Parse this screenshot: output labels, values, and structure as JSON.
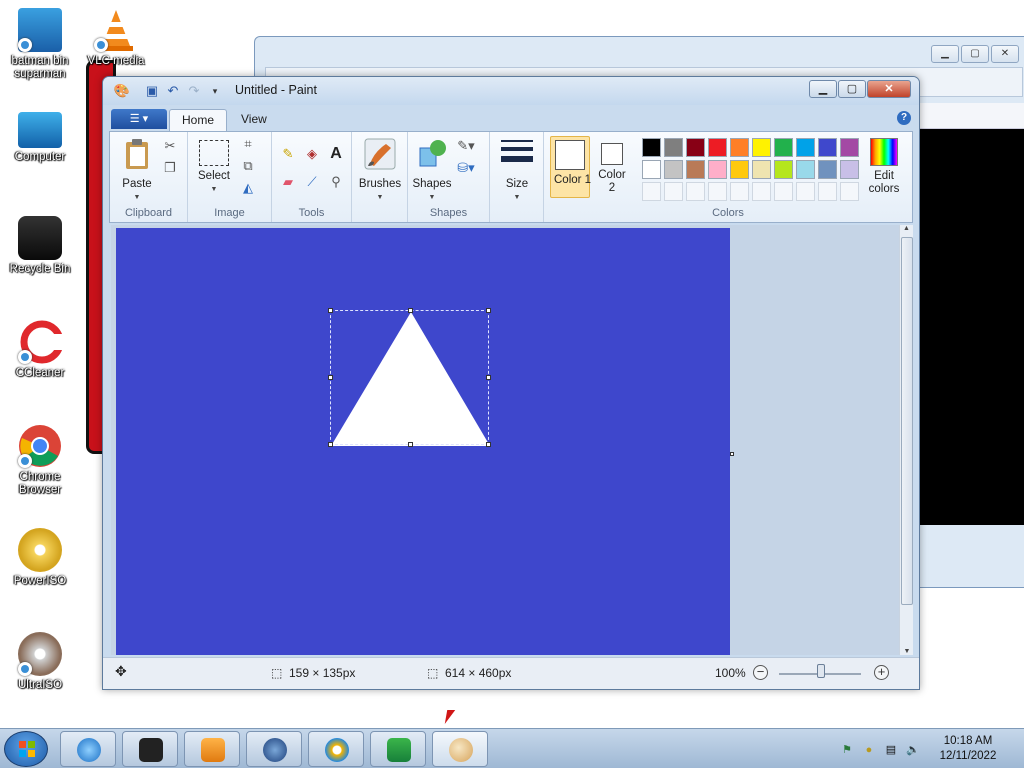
{
  "desktop": {
    "icons": [
      {
        "label": "batman bin suparman"
      },
      {
        "label": "VLC media"
      },
      {
        "label": "Computer"
      },
      {
        "label": "Recycle Bin"
      },
      {
        "label": "CCleaner"
      },
      {
        "label": "Chrome Browser"
      },
      {
        "label": "PowerISO"
      },
      {
        "label": "UltraISO"
      }
    ]
  },
  "paint": {
    "title": "Untitled - Paint",
    "tabs": {
      "home": "Home",
      "view": "View"
    },
    "help": "?",
    "groups": {
      "clipboard": {
        "label": "Clipboard",
        "paste": "Paste"
      },
      "image": {
        "label": "Image",
        "select": "Select"
      },
      "tools": {
        "label": "Tools",
        "text_tool": "A"
      },
      "brushes": {
        "label": "Brushes"
      },
      "shapes": {
        "label": "Shapes",
        "shapes_btn": "Shapes"
      },
      "size": {
        "label": "Size"
      },
      "colors": {
        "label": "Colors",
        "color1": "Color 1",
        "color2": "Color 2",
        "edit_colors": "Edit colors",
        "color1_value": "#ffffff",
        "color2_value": "#ffffff",
        "palette_row1": [
          "#000000",
          "#7f7f7f",
          "#880015",
          "#ed1c24",
          "#ff7f27",
          "#fff200",
          "#22b14c",
          "#00a2e8",
          "#3f48cc",
          "#a349a4"
        ],
        "palette_row2": [
          "#ffffff",
          "#c3c3c3",
          "#b97a57",
          "#ffaec9",
          "#ffc90e",
          "#efe4b0",
          "#b5e61d",
          "#99d9ea",
          "#7092be",
          "#c8bfe7"
        ]
      }
    },
    "canvas": {
      "background": "#3e47cc",
      "shape_fill": "#ffffff"
    },
    "status": {
      "selection_size": "159 × 135px",
      "canvas_size": "614 × 460px",
      "zoom": "100%",
      "zoom_out": "−",
      "zoom_in": "+"
    }
  },
  "taskbar": {
    "clock_time": "10:18 AM",
    "clock_date": "12/11/2022"
  }
}
